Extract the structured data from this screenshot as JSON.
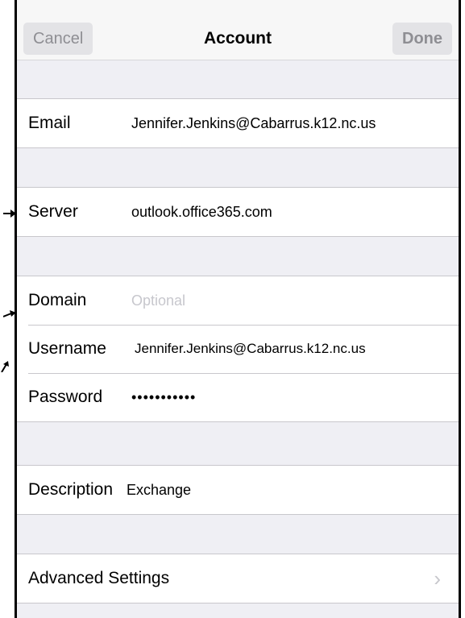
{
  "navbar": {
    "cancel_label": "Cancel",
    "title": "Account",
    "done_label": "Done"
  },
  "fields": {
    "email": {
      "label": "Email",
      "value": "Jennifer.Jenkins@Cabarrus.k12.nc.us"
    },
    "server": {
      "label": "Server",
      "value": "outlook.office365.com"
    },
    "domain": {
      "label": "Domain",
      "placeholder": "Optional"
    },
    "username": {
      "label": "Username",
      "value": "Jennifer.Jenkins@Cabarrus.k12.nc.us"
    },
    "password": {
      "label": "Password",
      "value": "•••••••••••"
    },
    "description": {
      "label": "Description",
      "value": "Exchange"
    }
  },
  "advanced": {
    "label": "Advanced Settings",
    "chevron": "›"
  },
  "colors": {
    "background": "#efeff4",
    "navbar": "#f7f7f7",
    "placeholder": "#c7c7cd",
    "separator": "#c8c7cc"
  },
  "icons": [
    "arrow-right-icon",
    "chevron-right-icon"
  ]
}
